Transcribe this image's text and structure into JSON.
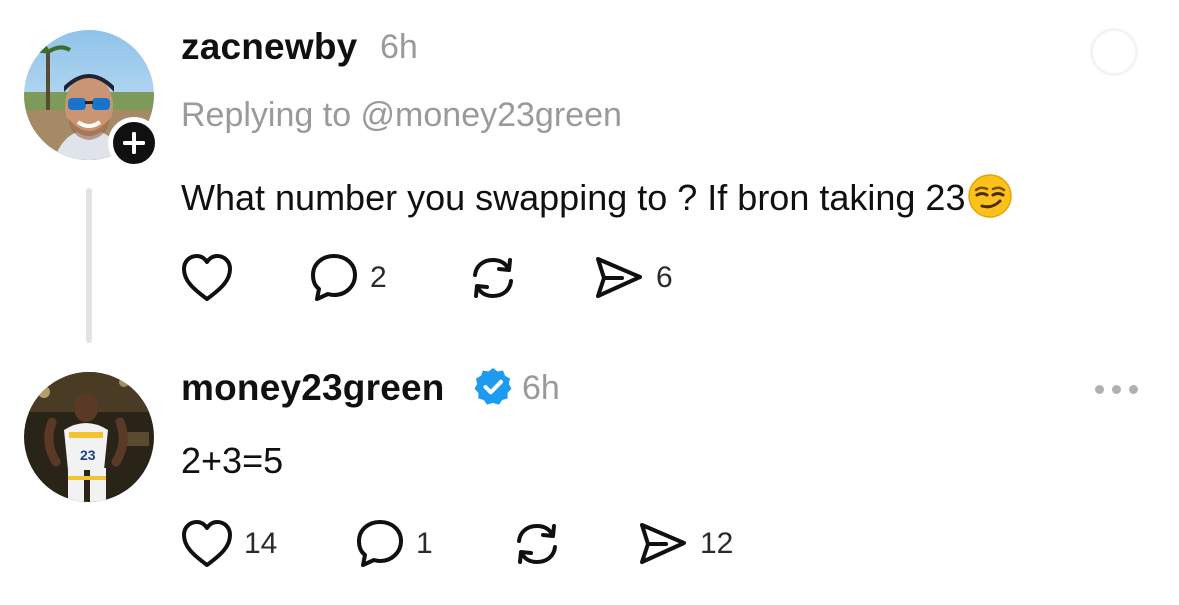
{
  "post1": {
    "username": "zacnewby",
    "time": "6h",
    "replying_to": "Replying to @money23green",
    "text": "What number you swapping to ? If bron taking 23",
    "emoji": "😏",
    "likes": "",
    "replies": "2",
    "reposts": "",
    "shares": "6"
  },
  "post2": {
    "username": "money23green",
    "time": "6h",
    "text": "2+3=5",
    "likes": "14",
    "replies": "1",
    "reposts": "",
    "shares": "12"
  },
  "icons": {
    "like": "heart-icon",
    "reply": "comment-icon",
    "repost": "repost-icon",
    "share": "share-icon",
    "more": "more-options-icon",
    "verified": "verified-badge-icon",
    "follow": "plus-icon"
  },
  "colors": {
    "verified": "#1d9bf0",
    "muted_text": "#9a9a9a",
    "thread_line": "#e3e3e3"
  }
}
